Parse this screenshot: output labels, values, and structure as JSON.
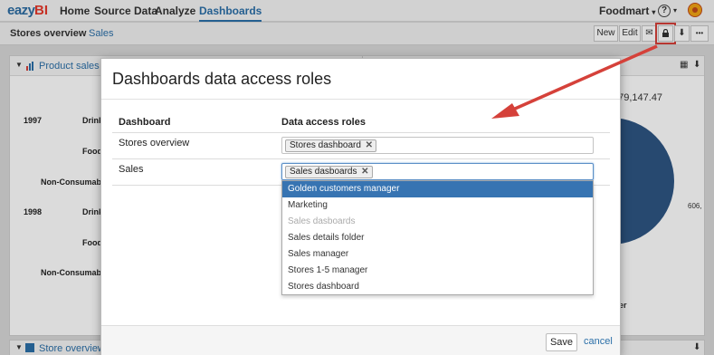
{
  "app": {
    "logo_text": "eazyBI"
  },
  "nav": {
    "items": [
      {
        "label": "Home"
      },
      {
        "label": "Source Data"
      },
      {
        "label": "Analyze"
      },
      {
        "label": "Dashboards"
      }
    ],
    "account": "Foodmart",
    "help_icon": "?",
    "caret": "▾"
  },
  "dashboard_tabs": [
    {
      "label": "Stores overview"
    },
    {
      "label": "Sales"
    }
  ],
  "toolbar": {
    "new_label": "New",
    "edit_label": "Edit",
    "mail_icon": "✉",
    "lock_icon": "🔒",
    "download_icon": "⬇",
    "more_icon": "•••",
    "highlight_color": "#d5413a"
  },
  "background": {
    "portlet_title": "Product sales / c",
    "portlet_bottom_title": "Store overview",
    "rows": [
      {
        "year": "1997",
        "cat": "Drink"
      },
      {
        "cat": "Food"
      },
      {
        "cat": "Non-Consumable"
      },
      {
        "year": "1998",
        "cat": "Drink"
      },
      {
        "cat": "Food"
      },
      {
        "cat": "Non-Consumable"
      }
    ],
    "value_label": "079,147.47",
    "pie_label": "606,",
    "legend_fragment": "er"
  },
  "modal": {
    "title": "Dashboards data access roles",
    "col_dashboard": "Dashboard",
    "col_roles": "Data access roles",
    "rows": [
      {
        "dashboard": "Stores overview",
        "tag": "Stores dashboard"
      },
      {
        "dashboard": "Sales",
        "tag": "Sales dasboards"
      }
    ],
    "tag_remove": "✕",
    "options": [
      {
        "label": "Golden customers manager"
      },
      {
        "label": "Marketing"
      },
      {
        "label": "Sales dasboards"
      },
      {
        "label": "Sales details folder"
      },
      {
        "label": "Sales manager"
      },
      {
        "label": "Stores 1-5 manager"
      },
      {
        "label": "Stores dashboard"
      }
    ],
    "save_label": "Save",
    "cancel_label": "cancel",
    "accent_color": "#3774b2"
  }
}
